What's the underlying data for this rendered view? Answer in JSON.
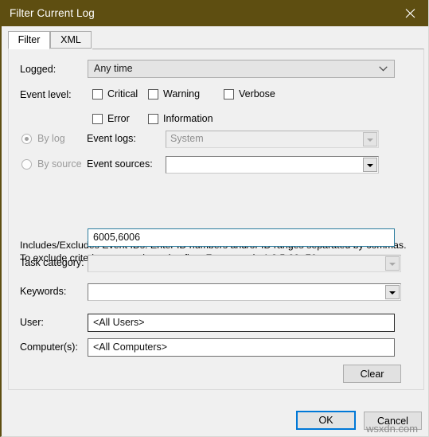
{
  "window": {
    "title": "Filter Current Log",
    "close_icon": "close-icon",
    "titlebar_color": "#5e4e11"
  },
  "tabs": [
    {
      "label": "Filter",
      "active": true
    },
    {
      "label": "XML",
      "active": false
    }
  ],
  "form": {
    "logged": {
      "label": "Logged:",
      "value": "Any time",
      "enabled": true
    },
    "event_level": {
      "label": "Event level:",
      "checkboxes": [
        {
          "label": "Critical",
          "checked": false
        },
        {
          "label": "Warning",
          "checked": false
        },
        {
          "label": "Verbose",
          "checked": false
        },
        {
          "label": "Error",
          "checked": false
        },
        {
          "label": "Information",
          "checked": false
        }
      ]
    },
    "source_mode": {
      "by_log": {
        "label": "By log",
        "selected": true,
        "enabled": false
      },
      "by_source": {
        "label": "By source",
        "selected": false,
        "enabled": false
      }
    },
    "event_logs": {
      "label": "Event logs:",
      "value": "System",
      "enabled": false
    },
    "event_sources": {
      "label": "Event sources:",
      "value": "",
      "enabled": true
    },
    "event_ids": {
      "hint": "Includes/Excludes Event IDs: Enter ID numbers and/or ID ranges separated by commas. To exclude criteria, type a minus sign first. For example 1,3,5-99,-76",
      "value": "6005,6006",
      "focused": true,
      "focus_color": "#2b7c9e"
    },
    "task_category": {
      "label": "Task category:",
      "value": "",
      "enabled": false
    },
    "keywords": {
      "label": "Keywords:",
      "value": "",
      "enabled": true
    },
    "user": {
      "label": "User:",
      "value": "<All Users>"
    },
    "computers": {
      "label": "Computer(s):",
      "value": "<All Computers>"
    },
    "clear_button": "Clear"
  },
  "footer": {
    "ok_label": "OK",
    "cancel_label": "Cancel",
    "default_accent": "#0078d7"
  },
  "watermark": "wsxdn.com"
}
